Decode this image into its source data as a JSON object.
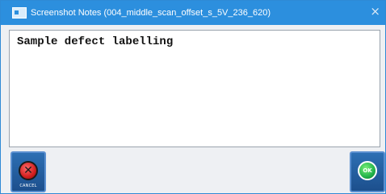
{
  "window": {
    "title": "Screenshot Notes (004_middle_scan_offset_s_5V_236_620)",
    "close_glyph": "×",
    "app_icon": "window-icon"
  },
  "notes": {
    "value": "Sample defect labelling"
  },
  "buttons": {
    "cancel": {
      "icon": "red-x-circle-icon",
      "glyph": "✕",
      "label": "CANCEL"
    },
    "ok": {
      "icon": "green-ok-circle-icon",
      "glyph": "OK"
    }
  },
  "colors": {
    "titlebar": "#2c8fde",
    "button": "#1f5799",
    "cancel_red": "#d11f1f",
    "ok_green": "#21b34a"
  }
}
